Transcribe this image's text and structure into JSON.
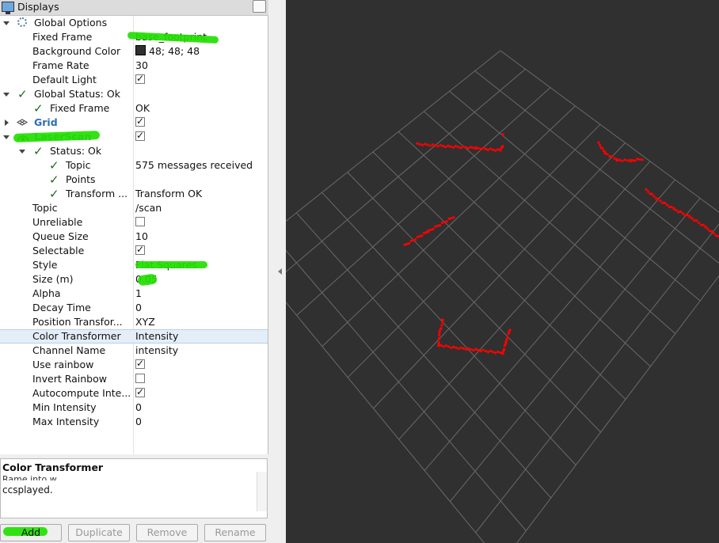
{
  "panel": {
    "title": "Displays"
  },
  "tree": {
    "global_options": {
      "label": "Global Options",
      "fixed_frame_label": "Fixed Frame",
      "fixed_frame_value": "base_footprint",
      "background_color_label": "Background Color",
      "background_color_value": "48; 48; 48",
      "background_color_hex": "#303030",
      "frame_rate_label": "Frame Rate",
      "frame_rate_value": "30",
      "default_light_label": "Default Light"
    },
    "global_status": {
      "label": "Global Status: Ok",
      "fixed_frame_label": "Fixed Frame",
      "fixed_frame_value": "OK"
    },
    "grid": {
      "label": "Grid"
    },
    "laserscan": {
      "label": "LaserScan",
      "status_label": "Status: Ok",
      "topic_status_label": "Topic",
      "topic_status_value": "575 messages received",
      "points_label": "Points",
      "transform_label": "Transform ...",
      "transform_value": "Transform OK",
      "topic_label": "Topic",
      "topic_value": "/scan",
      "unreliable_label": "Unreliable",
      "queue_size_label": "Queue Size",
      "queue_size_value": "10",
      "selectable_label": "Selectable",
      "style_label": "Style",
      "style_value": "Flat Squares",
      "size_label": "Size (m)",
      "size_value": "0.05",
      "alpha_label": "Alpha",
      "alpha_value": "1",
      "decay_label": "Decay Time",
      "decay_value": "0",
      "pos_transformer_label": "Position Transfor...",
      "pos_transformer_value": "XYZ",
      "color_transformer_label": "Color Transformer",
      "color_transformer_value": "Intensity",
      "channel_label": "Channel Name",
      "channel_value": "intensity",
      "use_rainbow_label": "Use rainbow",
      "invert_rainbow_label": "Invert Rainbow",
      "autocompute_label": "Autocompute Inte...",
      "min_intensity_label": "Min Intensity",
      "min_intensity_value": "0",
      "max_intensity_label": "Max Intensity",
      "max_intensity_value": "0"
    }
  },
  "description": {
    "title": "Color Transformer",
    "line1": "Rame into w",
    "line2": "ccsplayed."
  },
  "buttons": {
    "add": "Add",
    "duplicate": "Duplicate",
    "remove": "Remove",
    "rename": "Rename"
  },
  "colors": {
    "highlight": "#22e000",
    "scan_points": "#ff0000",
    "viewport_bg": "#303030",
    "grid_lines": "#6a6a6a"
  }
}
